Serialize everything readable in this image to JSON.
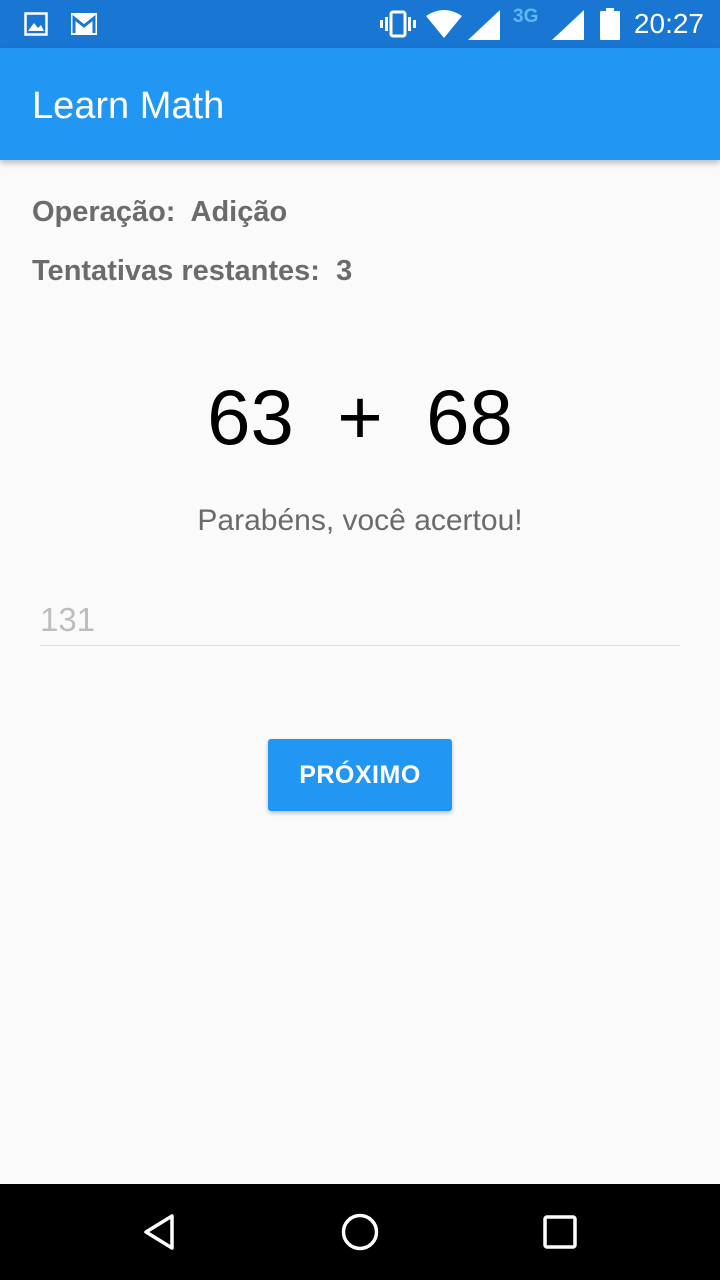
{
  "status_bar": {
    "time": "20:27",
    "network_label": "3G",
    "icons": [
      "image-notification-icon",
      "gmail-icon",
      "vibrate-icon",
      "wifi-icon",
      "signal-icon",
      "signal-3g-icon",
      "battery-icon"
    ]
  },
  "app_bar": {
    "title": "Learn Math"
  },
  "operation": {
    "label": "Operação:",
    "value": "Adição"
  },
  "attempts": {
    "label": "Tentativas restantes:",
    "value": "3"
  },
  "equation": {
    "operand1": "63",
    "operator": "+",
    "operand2": "68"
  },
  "feedback": "Parabéns, você acertou!",
  "answer_input": {
    "value": "131"
  },
  "next_button": {
    "label": "PRÓXIMO"
  },
  "nav_bar": {
    "icons": [
      "back-icon",
      "home-icon",
      "recents-icon"
    ]
  },
  "colors": {
    "status_bar": "#1976d2",
    "app_bar": "#2196f3",
    "button": "#2196f3",
    "background": "#fafafa"
  }
}
